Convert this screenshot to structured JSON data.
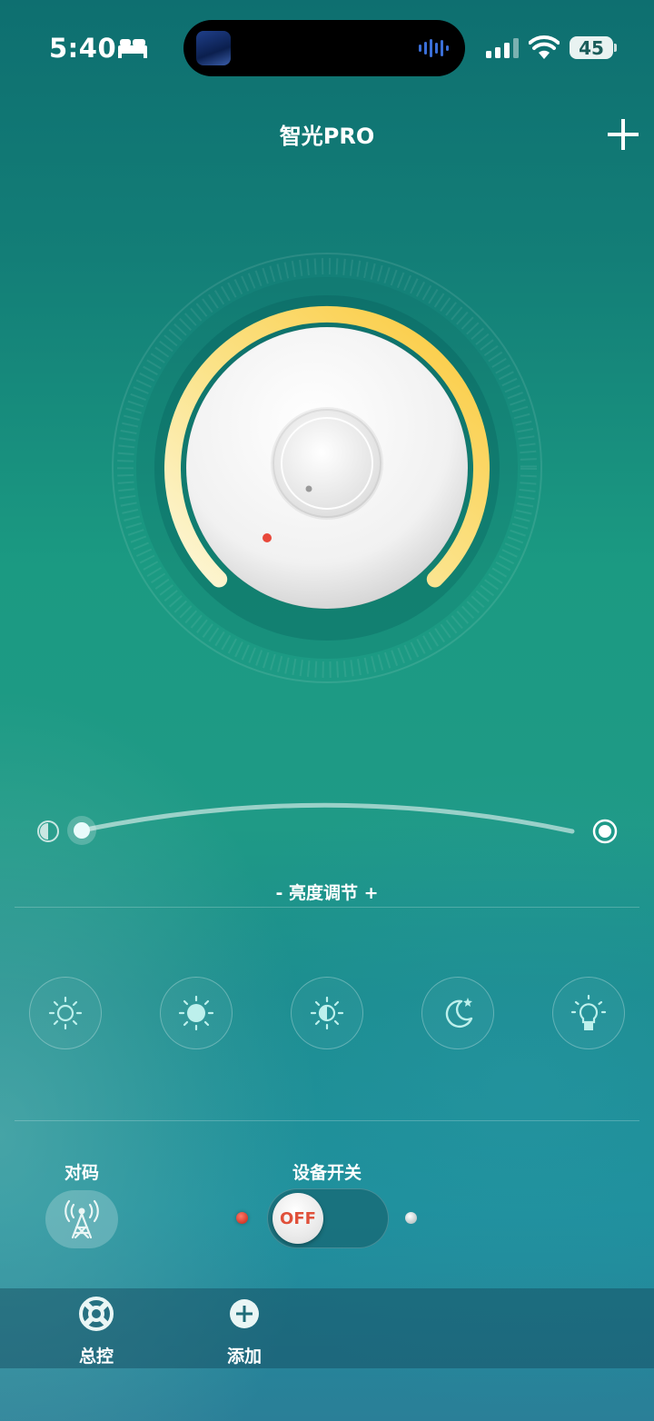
{
  "status_bar": {
    "time": "5:40",
    "battery": "45"
  },
  "header": {
    "title": "智光PRO"
  },
  "dial": {
    "level": 0.78,
    "arc_color_start": "#fdf7d9",
    "arc_color_end": "#fbc93c"
  },
  "slider": {
    "value": 0.05,
    "label": "- 亮度调节 +"
  },
  "modes": [
    {
      "icon": "sun-outline-icon"
    },
    {
      "icon": "sun-filled-icon"
    },
    {
      "icon": "sun-half-icon"
    },
    {
      "icon": "moon-star-icon"
    },
    {
      "icon": "bulb-icon"
    }
  ],
  "controls": {
    "pair_label": "对码",
    "power_label": "设备开关",
    "toggle_state": "OFF"
  },
  "nav": {
    "items": [
      {
        "label": "总控"
      },
      {
        "label": "添加"
      }
    ]
  },
  "colors": {
    "accent_red": "#e0503a",
    "arc_yellow": "#fbc93c"
  }
}
